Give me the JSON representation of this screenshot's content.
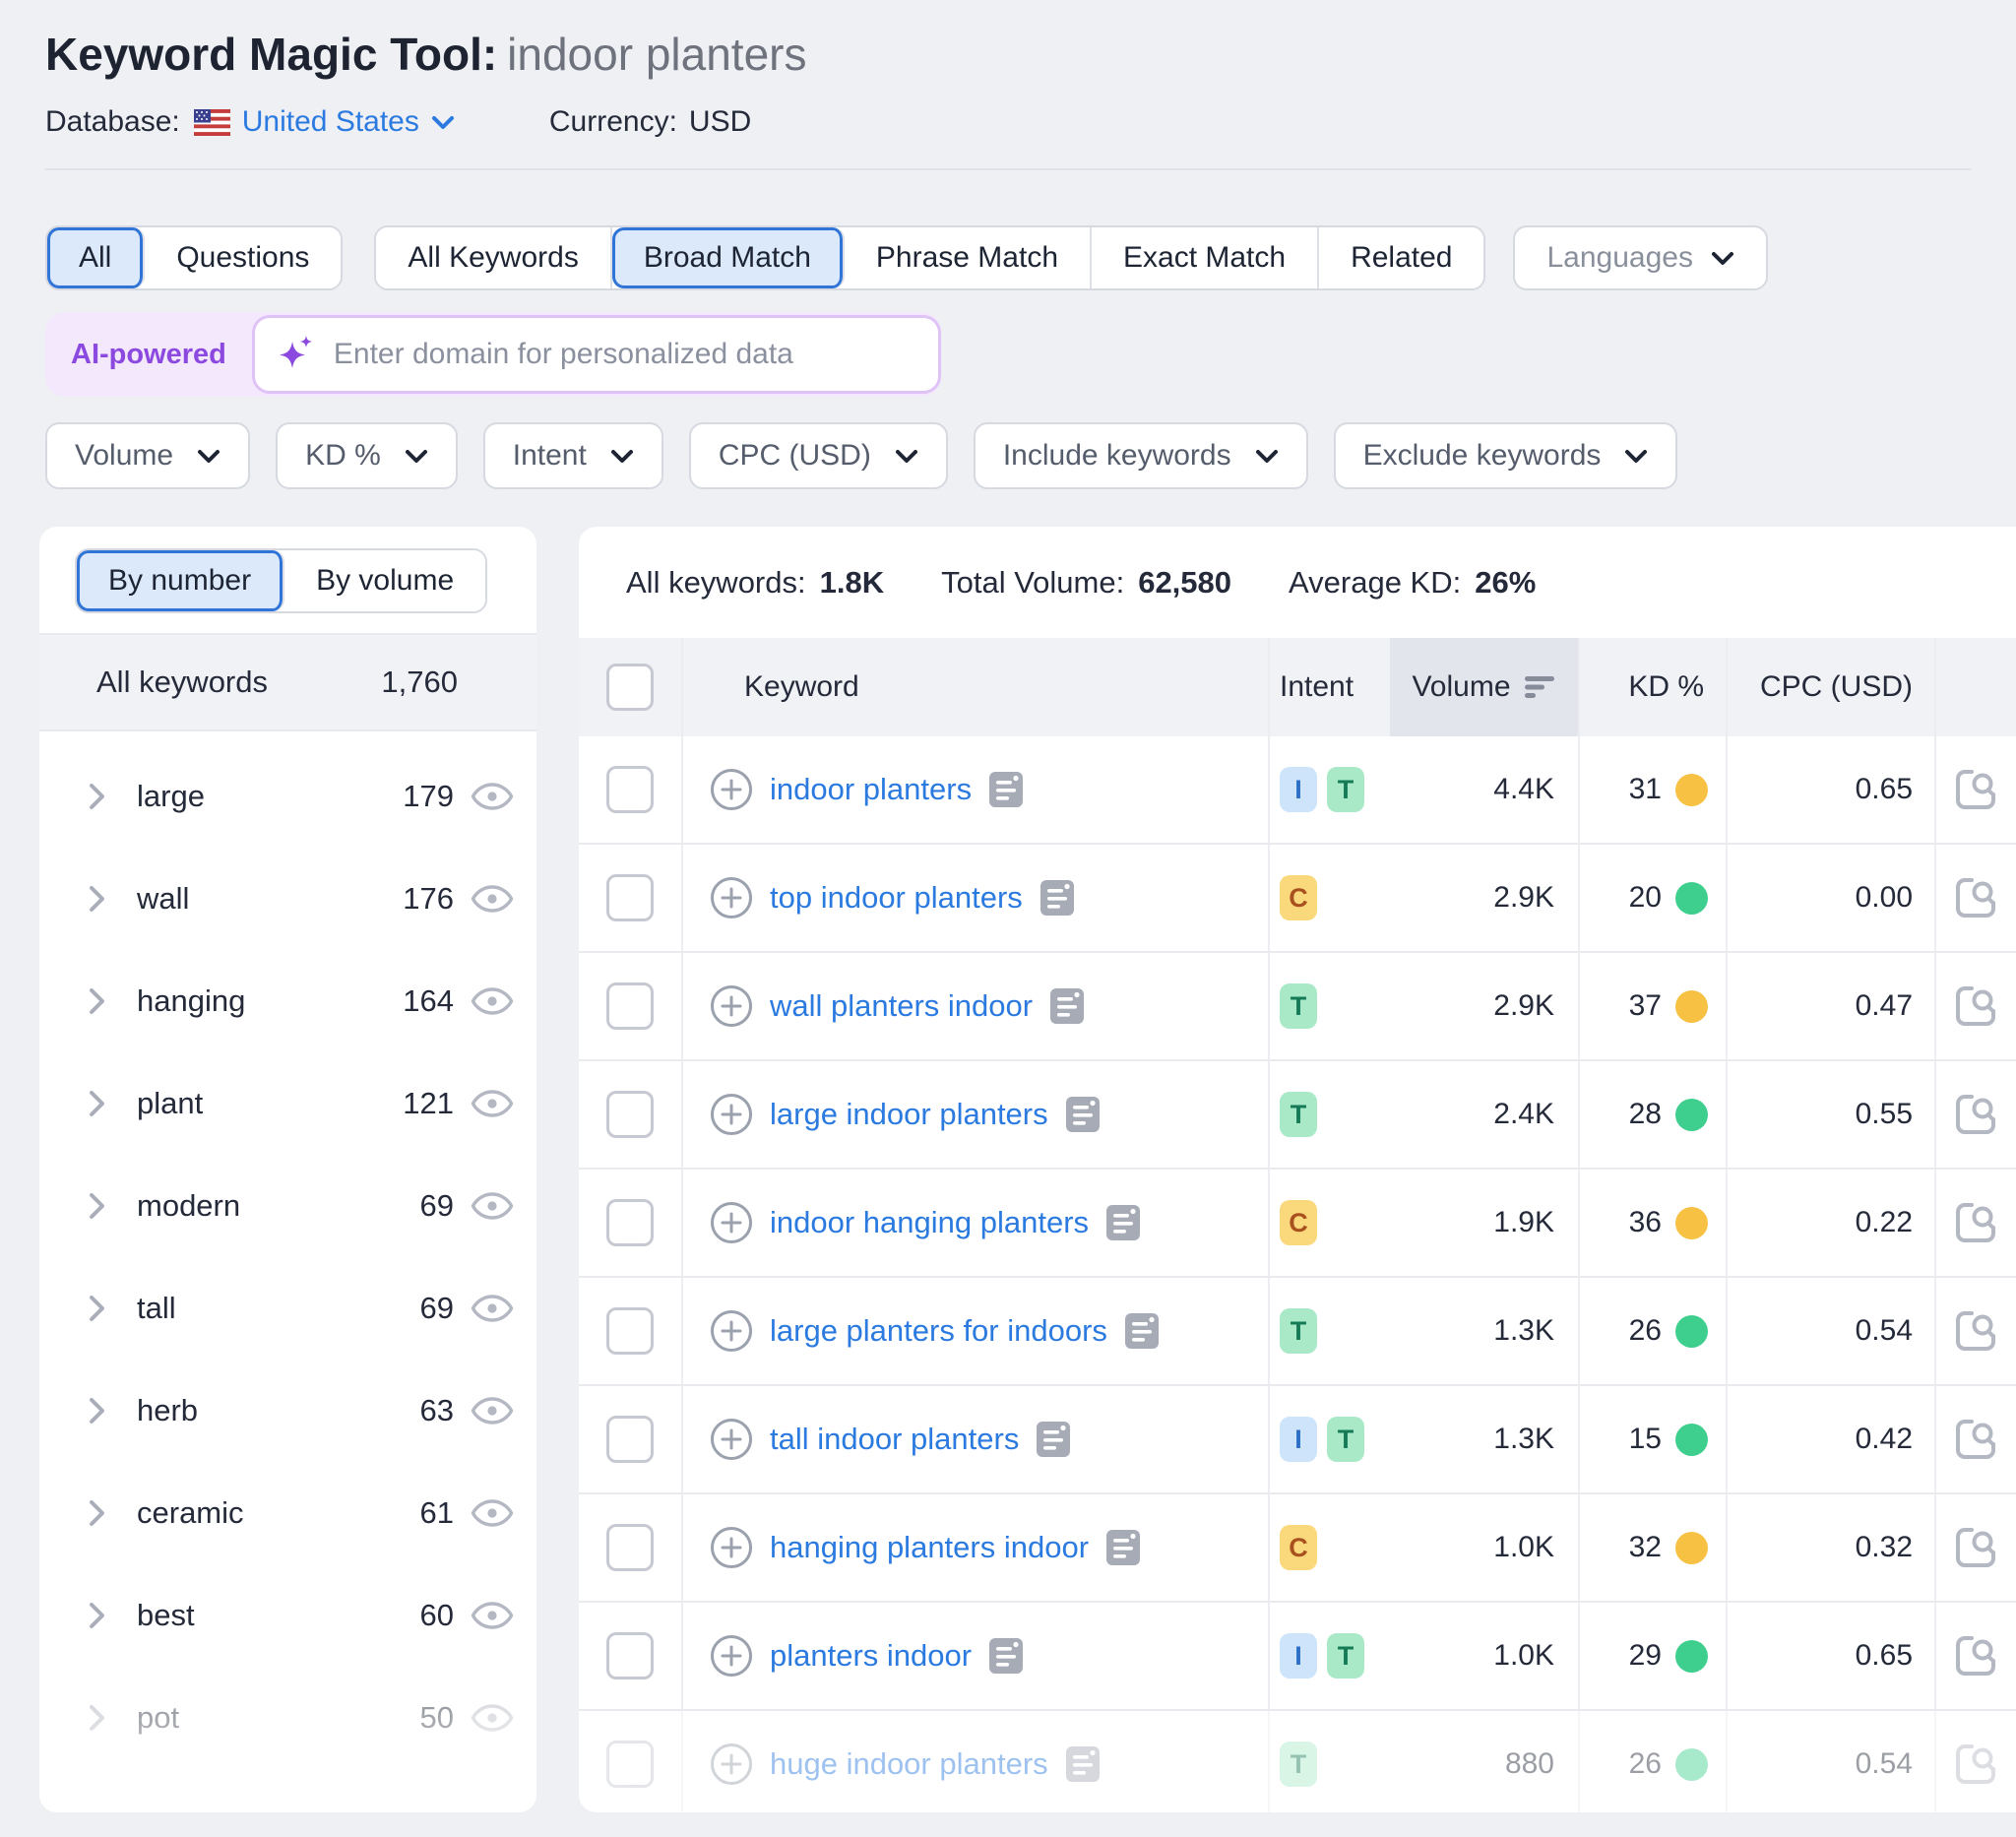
{
  "header": {
    "title": "Keyword Magic Tool:",
    "query": "indoor planters",
    "database_label": "Database:",
    "database_value": "United States",
    "currency_label": "Currency:",
    "currency_value": "USD"
  },
  "tabs": {
    "group1": [
      {
        "label": "All",
        "selected": true
      },
      {
        "label": "Questions",
        "selected": false
      }
    ],
    "group2": [
      {
        "label": "All Keywords",
        "selected": false
      },
      {
        "label": "Broad Match",
        "selected": true
      },
      {
        "label": "Phrase Match",
        "selected": false
      },
      {
        "label": "Exact Match",
        "selected": false
      },
      {
        "label": "Related",
        "selected": false
      }
    ],
    "languages_label": "Languages"
  },
  "ai": {
    "badge_label": "AI-powered",
    "input_value": "",
    "placeholder": "Enter domain for personalized data"
  },
  "filters": [
    {
      "label": "Volume"
    },
    {
      "label": "KD %"
    },
    {
      "label": "Intent"
    },
    {
      "label": "CPC (USD)"
    },
    {
      "label": "Include keywords"
    },
    {
      "label": "Exclude keywords"
    }
  ],
  "sidebar": {
    "toggle": [
      {
        "label": "By number",
        "selected": true
      },
      {
        "label": "By volume",
        "selected": false
      }
    ],
    "all_row": {
      "label": "All keywords",
      "count": "1,760"
    },
    "groups": [
      {
        "label": "large",
        "count": "179"
      },
      {
        "label": "wall",
        "count": "176"
      },
      {
        "label": "hanging",
        "count": "164"
      },
      {
        "label": "plant",
        "count": "121"
      },
      {
        "label": "modern",
        "count": "69"
      },
      {
        "label": "tall",
        "count": "69"
      },
      {
        "label": "herb",
        "count": "63"
      },
      {
        "label": "ceramic",
        "count": "61"
      },
      {
        "label": "best",
        "count": "60"
      },
      {
        "label": "pot",
        "count": "50",
        "faded": true
      }
    ]
  },
  "table": {
    "stats": [
      {
        "label": "All keywords:",
        "value": "1.8K"
      },
      {
        "label": "Total Volume:",
        "value": "62,580"
      },
      {
        "label": "Average KD:",
        "value": "26%"
      }
    ],
    "columns": {
      "keyword": "Keyword",
      "intent": "Intent",
      "volume": "Volume",
      "kd": "KD %",
      "cpc": "CPC (USD)"
    },
    "rows": [
      {
        "keyword": "indoor planters",
        "intents": [
          "I",
          "T"
        ],
        "volume": "4.4K",
        "kd": "31",
        "kd_color": "yellow",
        "cpc": "0.65"
      },
      {
        "keyword": "top indoor planters",
        "intents": [
          "C"
        ],
        "volume": "2.9K",
        "kd": "20",
        "kd_color": "green",
        "cpc": "0.00"
      },
      {
        "keyword": "wall planters indoor",
        "intents": [
          "T"
        ],
        "volume": "2.9K",
        "kd": "37",
        "kd_color": "yellow",
        "cpc": "0.47"
      },
      {
        "keyword": "large indoor planters",
        "intents": [
          "T"
        ],
        "volume": "2.4K",
        "kd": "28",
        "kd_color": "green",
        "cpc": "0.55"
      },
      {
        "keyword": "indoor hanging planters",
        "intents": [
          "C"
        ],
        "volume": "1.9K",
        "kd": "36",
        "kd_color": "yellow",
        "cpc": "0.22"
      },
      {
        "keyword": "large planters for indoors",
        "intents": [
          "T"
        ],
        "volume": "1.3K",
        "kd": "26",
        "kd_color": "green",
        "cpc": "0.54"
      },
      {
        "keyword": "tall indoor planters",
        "intents": [
          "I",
          "T"
        ],
        "volume": "1.3K",
        "kd": "15",
        "kd_color": "green",
        "cpc": "0.42"
      },
      {
        "keyword": "hanging planters indoor",
        "intents": [
          "C"
        ],
        "volume": "1.0K",
        "kd": "32",
        "kd_color": "yellow",
        "cpc": "0.32"
      },
      {
        "keyword": "planters indoor",
        "intents": [
          "I",
          "T"
        ],
        "volume": "1.0K",
        "kd": "29",
        "kd_color": "green",
        "cpc": "0.65"
      },
      {
        "keyword": "huge indoor planters",
        "intents": [
          "T"
        ],
        "volume": "880",
        "kd": "26",
        "kd_color": "green",
        "cpc": "0.54",
        "faded": true
      }
    ]
  },
  "icons": {
    "flag": "us-flag-icon",
    "db_chevron": "chevron-down-icon",
    "sparkle": "sparkle-icon",
    "sort": "sort-descending-icon",
    "eye": "eye-icon",
    "group_chevron": "chevron-right-icon",
    "add": "plus-circle-icon",
    "serp": "serp-features-icon",
    "serp_analyze": "serp-magnifier-icon"
  },
  "colors": {
    "page_bg": "#eef0f4",
    "accent_blue": "#2f74d6",
    "link_blue": "#2b7ae0",
    "ai_purple": "#8b49e0",
    "kd_green": "#3ecf8e",
    "kd_yellow": "#f7c143",
    "intent_i": "#2d6fc6",
    "intent_t": "#157a56",
    "intent_c": "#a8511f"
  }
}
